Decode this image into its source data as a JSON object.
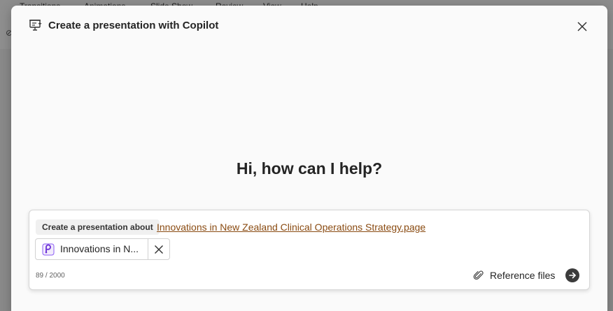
{
  "background_app": {
    "ribbon_tabs": [
      "Transitions",
      "Animations",
      "Slide Show",
      "Review",
      "View",
      "Help"
    ]
  },
  "dialog": {
    "title": "Create a presentation with Copilot",
    "greeting": "Hi, how can I help?"
  },
  "prompt": {
    "prefix_label": "Create a presentation about",
    "reference_link": "Innovations in New Zealand Clinical Operations Strategy.page",
    "attached_file": {
      "name": "Innovations in N...",
      "icon": "loop-page-icon"
    },
    "char_count": "89 / 2000",
    "reference_files_label": "Reference files"
  },
  "colors": {
    "link": "#8a4b12",
    "file_icon": "#6b2fd6",
    "send_button": "#3b3b3b"
  }
}
